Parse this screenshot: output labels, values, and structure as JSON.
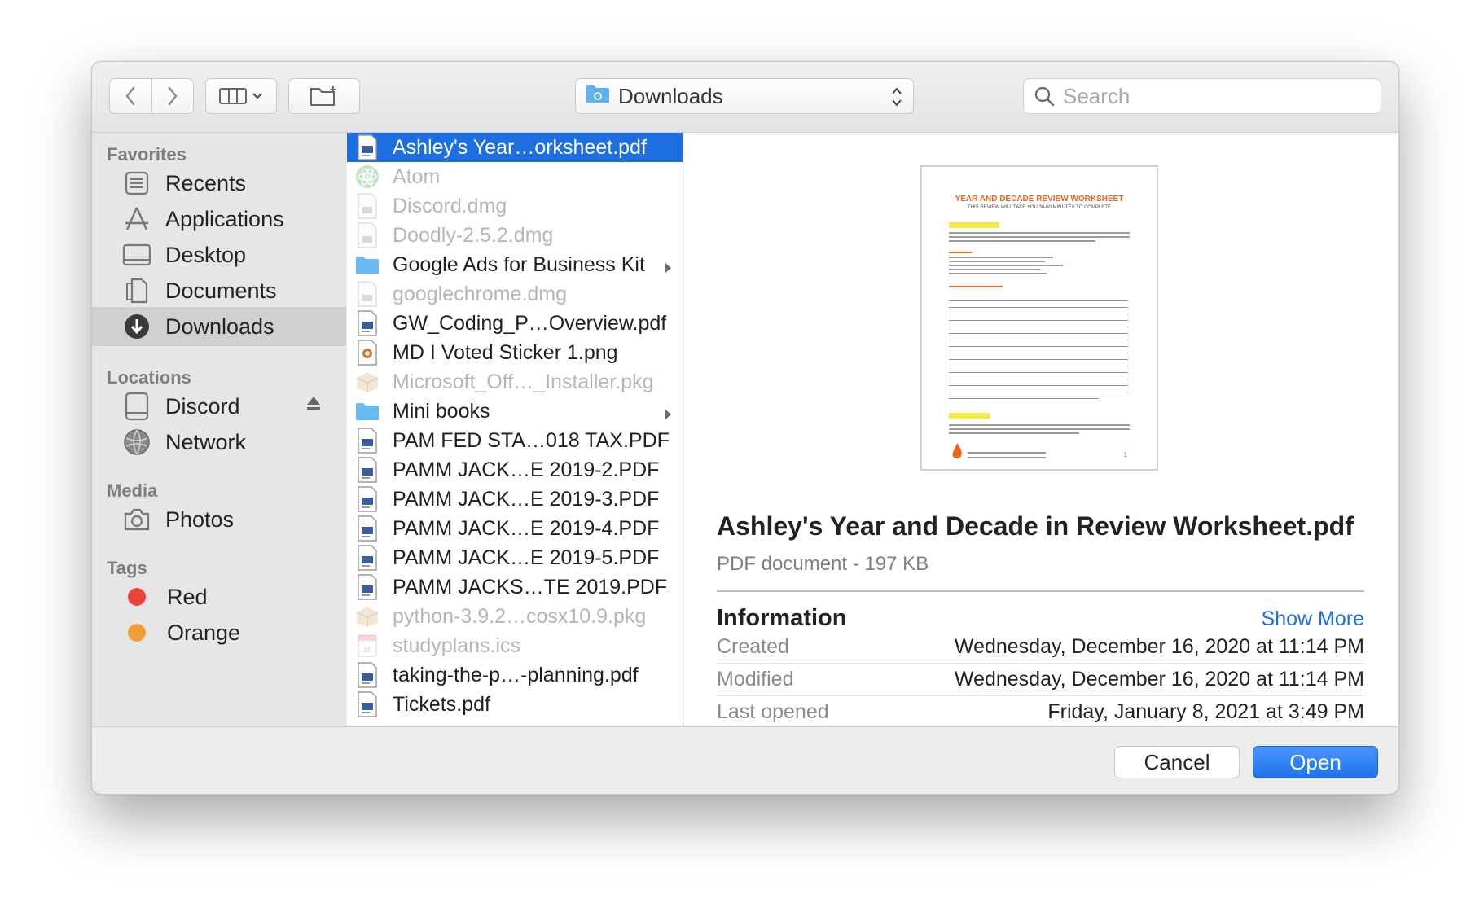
{
  "toolbar": {
    "path_label": "Downloads",
    "search_placeholder": "Search"
  },
  "sidebar": {
    "favorites_heading": "Favorites",
    "favorites": [
      {
        "label": "Recents",
        "icon": "recents-icon"
      },
      {
        "label": "Applications",
        "icon": "applications-icon"
      },
      {
        "label": "Desktop",
        "icon": "desktop-icon"
      },
      {
        "label": "Documents",
        "icon": "documents-icon"
      },
      {
        "label": "Downloads",
        "icon": "downloads-icon",
        "selected": true
      }
    ],
    "locations_heading": "Locations",
    "locations": [
      {
        "label": "Discord",
        "icon": "disk-icon"
      },
      {
        "label": "Network",
        "icon": "network-icon"
      }
    ],
    "media_heading": "Media",
    "media": [
      {
        "label": "Photos",
        "icon": "camera-icon"
      }
    ],
    "tags_heading": "Tags",
    "tags": [
      {
        "label": "Red",
        "color": "#e8453c"
      },
      {
        "label": "Orange",
        "color": "#f29c38"
      }
    ]
  },
  "files": [
    {
      "name": "Ashley's Year…orksheet.pdf",
      "type": "pdf",
      "selected": true
    },
    {
      "name": "Atom",
      "type": "app",
      "dim": true
    },
    {
      "name": "Discord.dmg",
      "type": "dmg",
      "dim": true
    },
    {
      "name": "Doodly-2.5.2.dmg",
      "type": "dmg",
      "dim": true
    },
    {
      "name": "Google Ads for Business Kit",
      "type": "folder",
      "folder": true
    },
    {
      "name": "googlechrome.dmg",
      "type": "dmg",
      "dim": true
    },
    {
      "name": "GW_Coding_P…Overview.pdf",
      "type": "pdf"
    },
    {
      "name": "MD I Voted Sticker 1.png",
      "type": "png"
    },
    {
      "name": "Microsoft_Off…_Installer.pkg",
      "type": "pkg",
      "dim": true
    },
    {
      "name": "Mini books",
      "type": "folder",
      "folder": true
    },
    {
      "name": "PAM FED STA…018 TAX.PDF",
      "type": "pdf"
    },
    {
      "name": "PAMM JACK…E 2019-2.PDF",
      "type": "pdf"
    },
    {
      "name": "PAMM JACK…E 2019-3.PDF",
      "type": "pdf"
    },
    {
      "name": "PAMM JACK…E 2019-4.PDF",
      "type": "pdf"
    },
    {
      "name": "PAMM JACK…E 2019-5.PDF",
      "type": "pdf"
    },
    {
      "name": "PAMM JACKS…TE 2019.PDF",
      "type": "pdf"
    },
    {
      "name": "python-3.9.2…cosx10.9.pkg",
      "type": "pkg",
      "dim": true
    },
    {
      "name": "studyplans.ics",
      "type": "ics",
      "dim": true
    },
    {
      "name": "taking-the-p…-planning.pdf",
      "type": "pdf"
    },
    {
      "name": "Tickets.pdf",
      "type": "pdf"
    }
  ],
  "preview": {
    "thumb_title": "YEAR AND DECADE REVIEW WORKSHEET",
    "thumb_subtitle": "THIS REVIEW WILL TAKE YOU 30-60 MINUTES TO COMPLETE",
    "thumb_page_number": "1",
    "title": "Ashley's Year and Decade in Review Worksheet.pdf",
    "subtitle": "PDF document - 197 KB",
    "info_heading": "Information",
    "show_more": "Show More",
    "info": [
      {
        "key": "Created",
        "value": "Wednesday, December 16, 2020 at 11:14 PM"
      },
      {
        "key": "Modified",
        "value": "Wednesday, December 16, 2020 at 11:14 PM"
      },
      {
        "key": "Last opened",
        "value": "Friday, January 8, 2021 at 3:49 PM"
      }
    ]
  },
  "buttons": {
    "cancel": "Cancel",
    "open": "Open"
  },
  "colors": {
    "accent": "#1d6fe0",
    "sidebar_selected": "#d0d0d0"
  }
}
